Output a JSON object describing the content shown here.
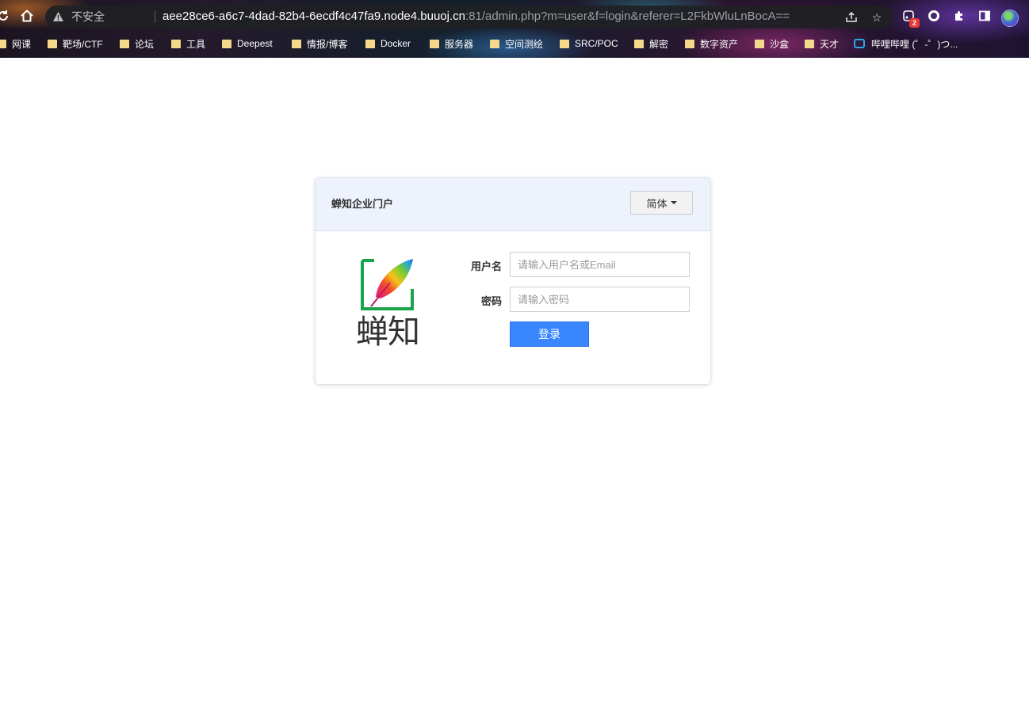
{
  "browser": {
    "security_label": "不安全",
    "url_host": "aee28ce6-a6c7-4dad-82b4-6ecdf4c47fa9.node4.buuoj.cn",
    "url_rest": ":81/admin.php?m=user&f=login&referer=L2FkbWluLnBocA==",
    "extension_badge": "2"
  },
  "bookmarks": [
    {
      "label": "网课",
      "icon": "folder-icon"
    },
    {
      "label": "靶场/CTF",
      "icon": "folder-icon"
    },
    {
      "label": "论坛",
      "icon": "folder-icon"
    },
    {
      "label": "工具",
      "icon": "folder-icon"
    },
    {
      "label": "Deepest",
      "icon": "folder-icon"
    },
    {
      "label": "情报/博客",
      "icon": "folder-icon"
    },
    {
      "label": "Docker",
      "icon": "folder-icon"
    },
    {
      "label": "服务器",
      "icon": "folder-icon"
    },
    {
      "label": "空间测绘",
      "icon": "folder-icon"
    },
    {
      "label": "SRC/POC",
      "icon": "folder-icon"
    },
    {
      "label": "解密",
      "icon": "folder-icon"
    },
    {
      "label": "数字资产",
      "icon": "folder-icon"
    },
    {
      "label": "沙盒",
      "icon": "folder-icon"
    },
    {
      "label": "天才",
      "icon": "folder-icon"
    },
    {
      "label": "哔哩哔哩 (゜-゜)つ...",
      "icon": "bilibili-icon"
    }
  ],
  "login": {
    "title": "蝉知企业门户",
    "language": "简体",
    "logo_text": "蝉知",
    "username_label": "用户名",
    "username_placeholder": "请输入用户名或Email",
    "username_value": "",
    "password_label": "密码",
    "password_placeholder": "请输入密码",
    "password_value": "",
    "submit_label": "登录"
  },
  "colors": {
    "accent": "#3a86ff",
    "header_bg": "#edf2fd",
    "logo_frame": "#1aa34a"
  }
}
